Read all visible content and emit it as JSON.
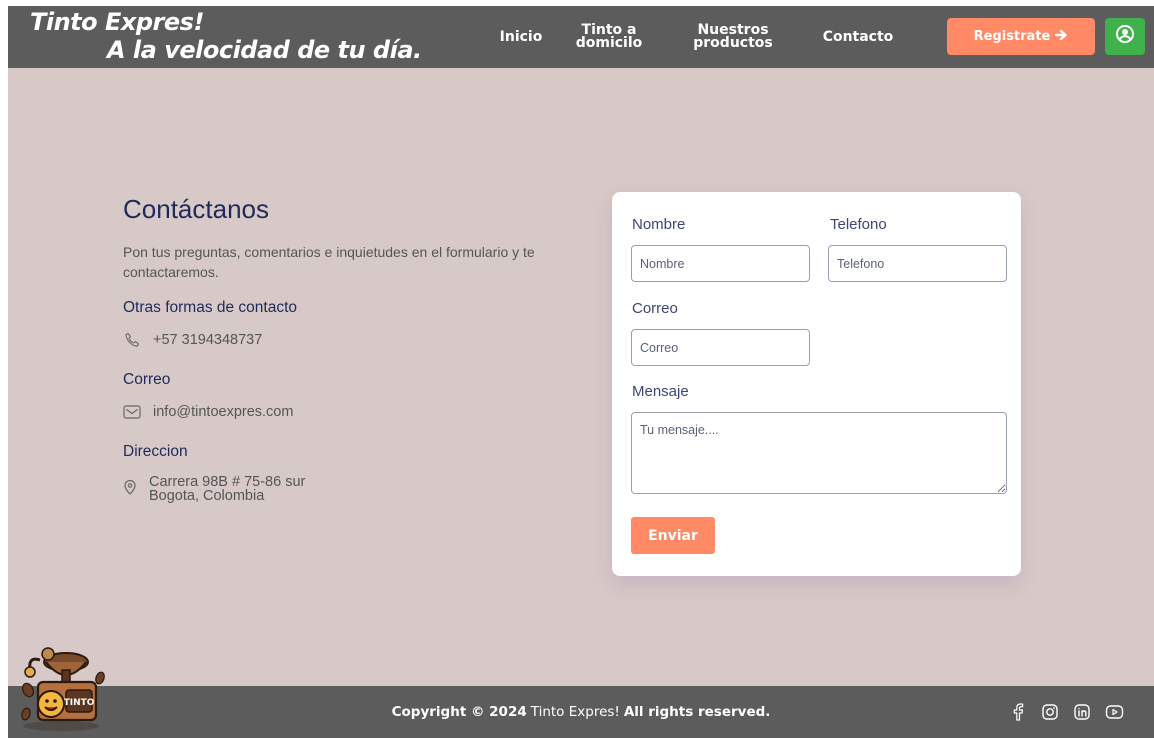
{
  "header": {
    "brand_line1": "Tinto Expres!",
    "brand_line2": "A la velocidad de tu día.",
    "nav": [
      {
        "label_line1": "Inicio",
        "label_line2": ""
      },
      {
        "label_line1": "Tinto a",
        "label_line2": "domicilo"
      },
      {
        "label_line1": "Nuestros",
        "label_line2": "productos"
      },
      {
        "label_line1": "Contacto",
        "label_line2": ""
      }
    ],
    "register_label": "Registrate",
    "register_icon": "arrow-right-icon",
    "user_icon": "user-circle-icon"
  },
  "contact": {
    "title": "Contáctanos",
    "description": "Pon tus preguntas, comentarios e inquietudes en el formulario y te contactaremos.",
    "other_forms_heading": "Otras formas de contacto",
    "phone": "+57 3194348737",
    "email_heading": "Correo",
    "email": "info@tintoexpres.com",
    "address_heading": "Direccion",
    "address_line1": "Carrera 98B # 75-86 sur",
    "address_line2": "Bogota, Colombia"
  },
  "form": {
    "name_label": "Nombre",
    "name_placeholder": "Nombre",
    "phone_label": "Telefono",
    "phone_placeholder": "Telefono",
    "email_label": "Correo",
    "email_placeholder": "Correo",
    "message_label": "Mensaje",
    "message_placeholder": "Tu mensaje....",
    "submit_label": "Enviar"
  },
  "footer": {
    "copyright_prefix": "Copyright © 2024",
    "brand": "Tinto Expres!",
    "copyright_suffix": "All rights reserved.",
    "socials": [
      "facebook-icon",
      "instagram-icon",
      "linkedin-icon",
      "youtube-icon"
    ],
    "mascot_text": "TINTO"
  },
  "colors": {
    "header_bg": "#5c5c5c",
    "page_bg": "#d7c9c7",
    "accent": "#ff8a65",
    "user_button": "#3fb24b",
    "heading": "#1f2a5a"
  }
}
